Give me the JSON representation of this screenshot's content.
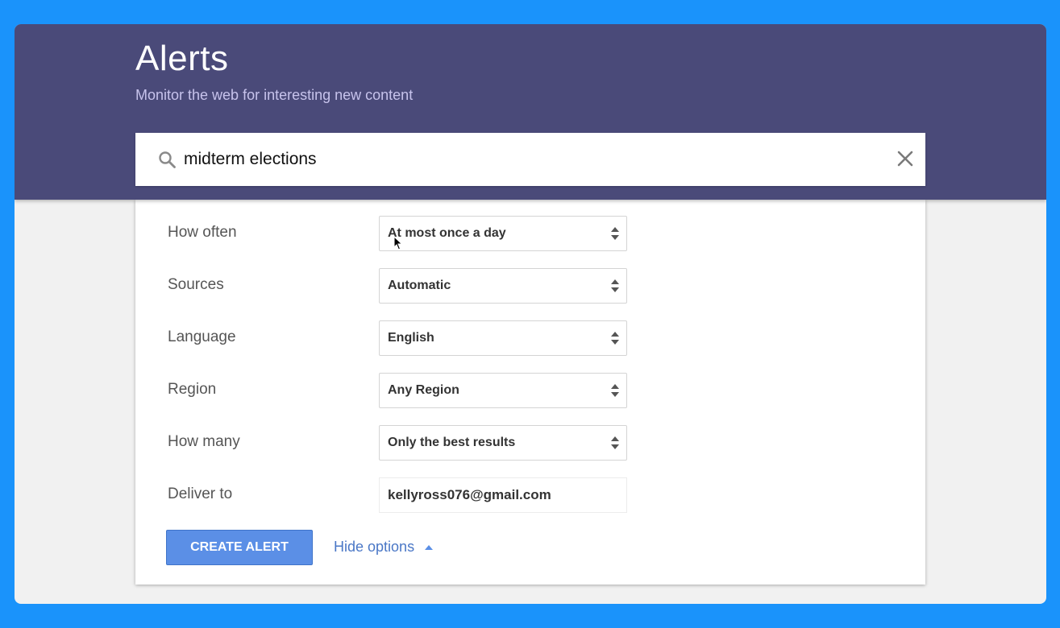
{
  "header": {
    "title": "Alerts",
    "subtitle": "Monitor the web for interesting new content"
  },
  "search": {
    "query": "midterm elections",
    "icon": "search-icon",
    "clear_icon": "close-icon"
  },
  "options": {
    "how_often": {
      "label": "How often",
      "value": "At most once a day"
    },
    "sources": {
      "label": "Sources",
      "value": "Automatic"
    },
    "language": {
      "label": "Language",
      "value": "English"
    },
    "region": {
      "label": "Region",
      "value": "Any Region"
    },
    "how_many": {
      "label": "How many",
      "value": "Only the best results"
    },
    "deliver_to": {
      "label": "Deliver to",
      "value": "kellyross076@gmail.com"
    }
  },
  "actions": {
    "create_label": "CREATE ALERT",
    "hide_options_label": "Hide options"
  },
  "colors": {
    "header_bg": "#4a4a79",
    "page_bg": "#1a93fb",
    "button_bg": "#5b8fe6",
    "link": "#4a77c6"
  }
}
